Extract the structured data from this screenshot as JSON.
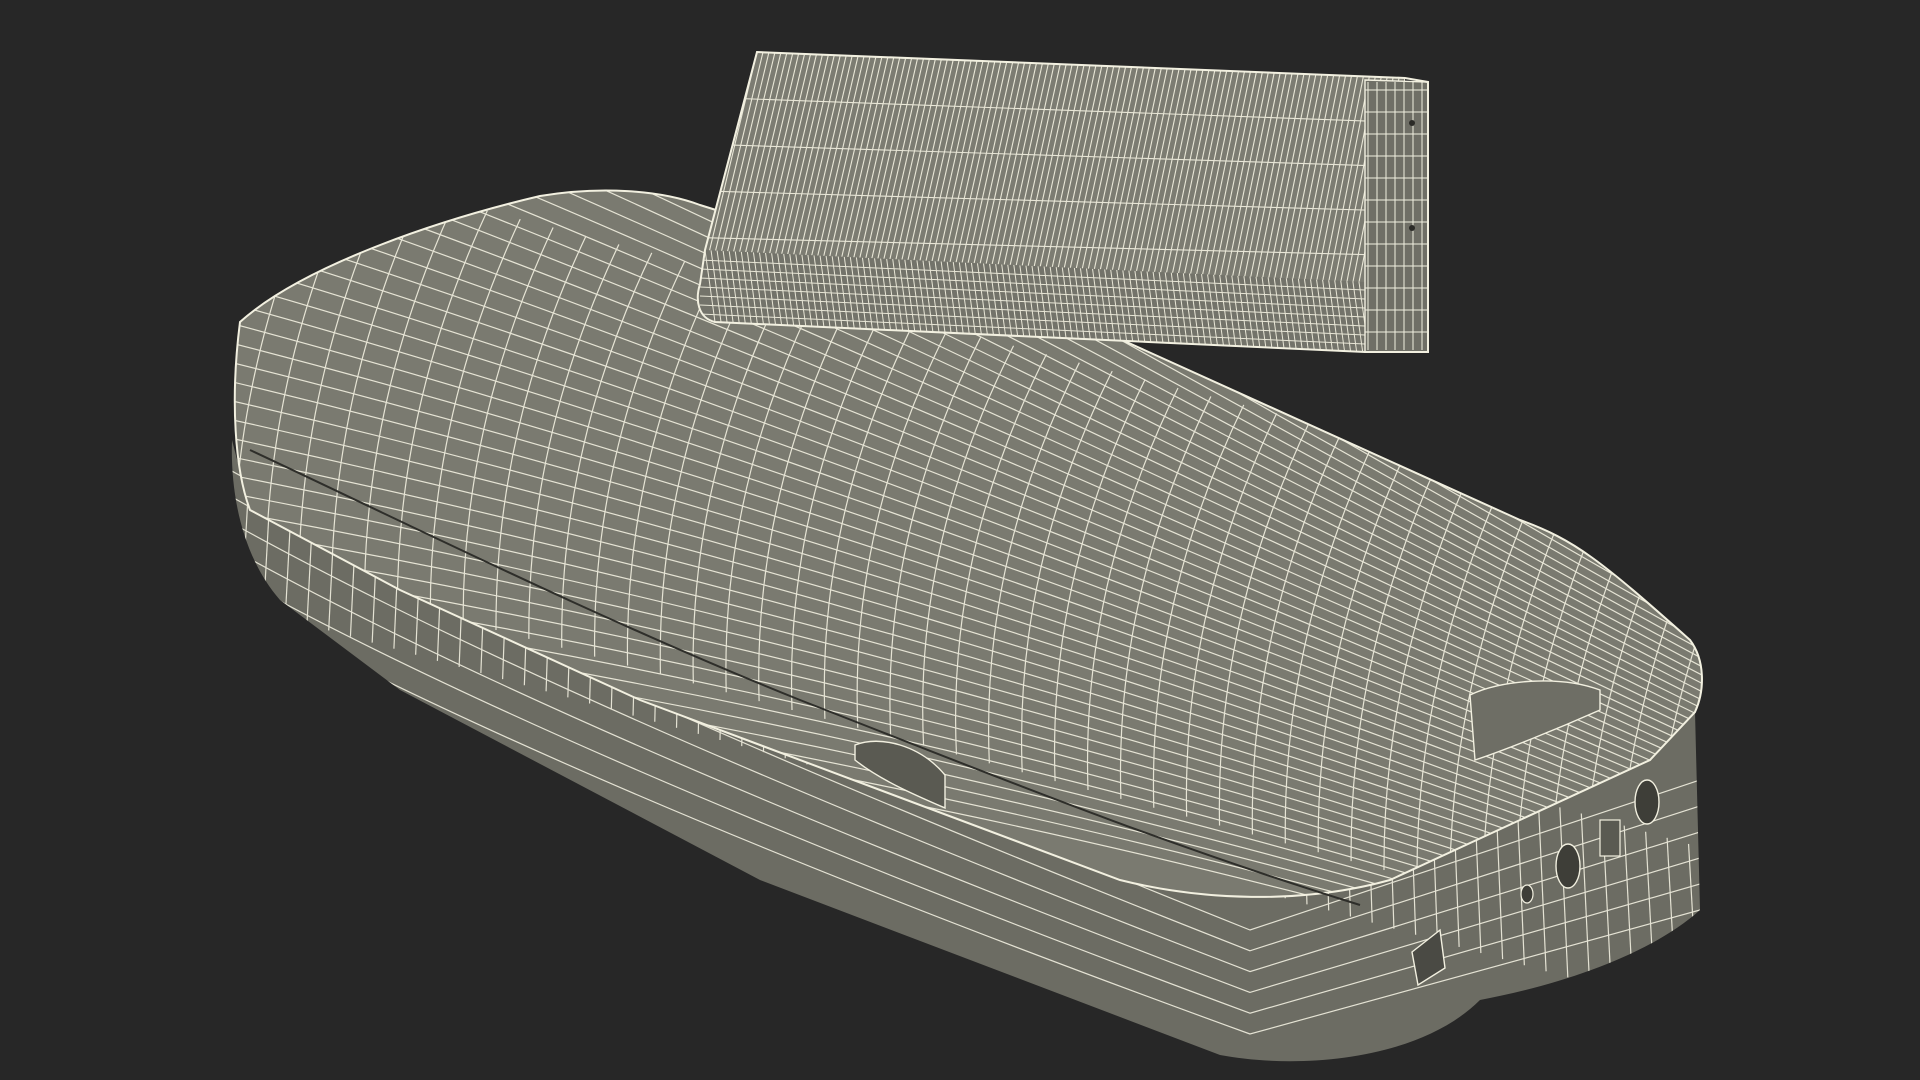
{
  "scene": {
    "background_color": "#272727",
    "model_fill_color": "#7a7a70",
    "model_shade_color": "#6c6c63",
    "wire_color": "#f2f0e0",
    "objects": [
      {
        "name": "phone-body",
        "view": "wireframe-shaded"
      },
      {
        "name": "battery",
        "view": "wireframe-shaded"
      }
    ]
  }
}
